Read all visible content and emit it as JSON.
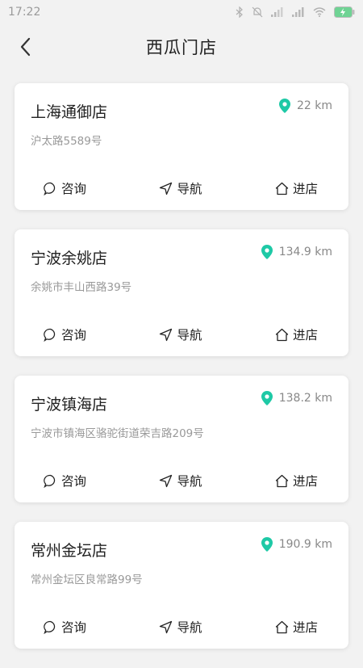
{
  "status_bar": {
    "time": "17:22",
    "battery": "100"
  },
  "header": {
    "title": "西瓜门店"
  },
  "colors": {
    "accent": "#1ec9a6",
    "background": "#f2f2f2"
  },
  "stores": [
    {
      "name": "上海通御店",
      "distance": "22 km",
      "address": "沪太路5589号",
      "actions": [
        "咨询",
        "导航",
        "进店"
      ]
    },
    {
      "name": "宁波余姚店",
      "distance": "134.9 km",
      "address": "余姚市丰山西路39号",
      "actions": [
        "咨询",
        "导航",
        "进店"
      ]
    },
    {
      "name": "宁波镇海店",
      "distance": "138.2 km",
      "address": "宁波市镇海区骆驼街道荣吉路209号",
      "actions": [
        "咨询",
        "导航",
        "进店"
      ]
    },
    {
      "name": "常州金坛店",
      "distance": "190.9 km",
      "address": "常州金坛区良常路99号",
      "actions": [
        "咨询",
        "导航",
        "进店"
      ]
    }
  ]
}
